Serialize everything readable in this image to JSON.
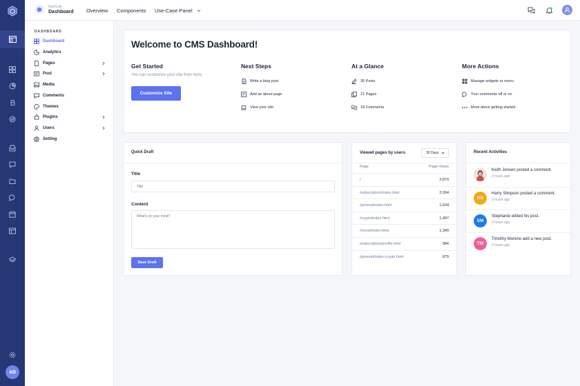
{
  "brand": {
    "subtitle": "DashLite",
    "title": "Dashboard"
  },
  "topnav": {
    "overview": "Overview",
    "components": "Components",
    "usecase": "Use-Case Panel"
  },
  "user": {
    "initials": "AB"
  },
  "sidebar": {
    "heading": "DASHBOARD",
    "items": [
      {
        "label": "Dashboard",
        "icon": "dashboard-icon",
        "active": true
      },
      {
        "label": "Analytics",
        "icon": "analytics-icon"
      },
      {
        "label": "Pages",
        "icon": "pages-icon",
        "submenu": true
      },
      {
        "label": "Post",
        "icon": "post-icon",
        "submenu": true
      },
      {
        "label": "Media",
        "icon": "media-icon"
      },
      {
        "label": "Comments",
        "icon": "comments-icon"
      },
      {
        "label": "Themes",
        "icon": "themes-icon"
      },
      {
        "label": "Plugins",
        "icon": "plugins-icon",
        "submenu": true
      },
      {
        "label": "Users",
        "icon": "users-icon",
        "submenu": true
      },
      {
        "label": "Setting",
        "icon": "setting-icon"
      }
    ]
  },
  "welcome": {
    "title": "Welcome to CMS Dashboard!",
    "get_started": {
      "title": "Get Started",
      "desc": "You can customize your site from here.",
      "button": "Customize Site"
    },
    "next_steps": {
      "title": "Next Steps",
      "items": [
        "Write a blog post",
        "Add an about page",
        "View your site"
      ]
    },
    "at_a_glance": {
      "title": "At a Glance",
      "items": [
        "35 Posts",
        "21 Pages",
        "18 Comments"
      ]
    },
    "more_actions": {
      "title": "More Actions",
      "items": [
        "Manage widgets or menu",
        "Trun comments off or on",
        "More about getting started"
      ]
    }
  },
  "quick_draft": {
    "title": "Quick Draft",
    "title_label": "Title",
    "title_placeholder": "Title",
    "content_label": "Content",
    "content_placeholder": "What's on your mind?",
    "button": "Save Draft"
  },
  "viewed_pages": {
    "title": "Viewed pages by users",
    "range": "30 Days",
    "col_page": "Page",
    "col_views": "Page Views",
    "rows": [
      {
        "page": "/",
        "views": "2,879"
      },
      {
        "page": "/subscription/index.html",
        "views": "2,094"
      },
      {
        "page": "/general/index.html",
        "views": "1,634"
      },
      {
        "page": "/crypto/index.html",
        "views": "1,497"
      },
      {
        "page": "/invest/index.html",
        "views": "1,349"
      },
      {
        "page": "/subscription/profile.html",
        "views": "984"
      },
      {
        "page": "/general/index-crypto.html",
        "views": "879"
      }
    ]
  },
  "recent_activities": {
    "title": "Recent Activities",
    "items": [
      {
        "initials": "",
        "photo": true,
        "color": "#c98a7a",
        "message": "Keith Jensen posted a comment.",
        "time": "2 hours ago"
      },
      {
        "initials": "HS",
        "color": "#f4a714",
        "message": "Harry Simpson posted a comment.",
        "time": "2 hours ago"
      },
      {
        "initials": "SM",
        "color": "#1d7af0",
        "message": "Stephanie edited his post.",
        "time": "2 hours ago"
      },
      {
        "initials": "TM",
        "color": "#f0609a",
        "message": "Timothy Moreno add a new post.",
        "time": "2 hours ago"
      }
    ]
  },
  "colors": {
    "accent": "#5d72f0",
    "rail": "#263776"
  }
}
